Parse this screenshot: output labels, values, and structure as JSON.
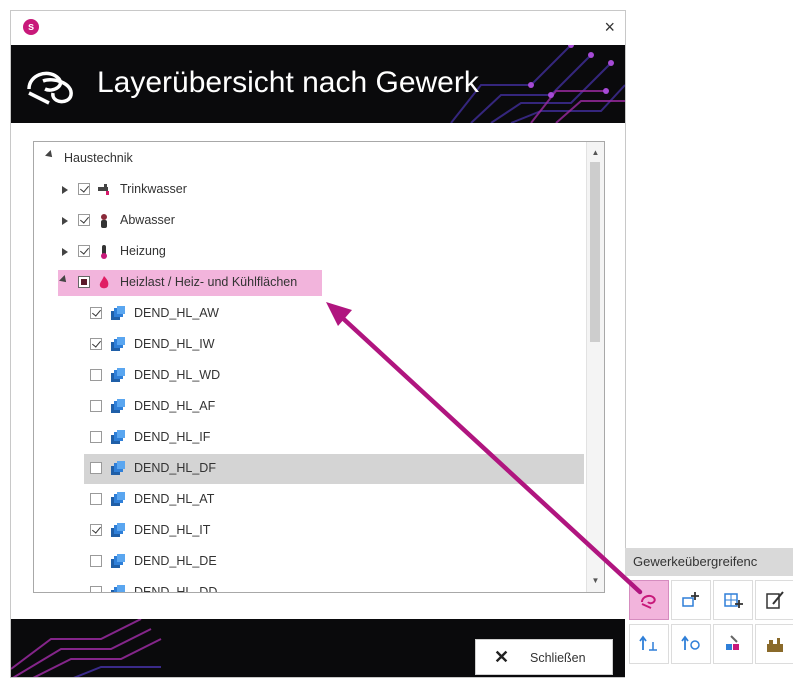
{
  "dialog": {
    "close_glyph": "×",
    "app_icon": "s-logo-icon",
    "app_icon_letter": "s",
    "title": "Layerübersicht nach Gewerk"
  },
  "tree": {
    "root": {
      "label": "Haustechnik",
      "expanded": true
    },
    "groups": [
      {
        "label": "Trinkwasser",
        "checked": true,
        "icon": "faucet-icon"
      },
      {
        "label": "Abwasser",
        "checked": true,
        "icon": "drain-icon"
      },
      {
        "label": "Heizung",
        "checked": true,
        "icon": "thermometer-icon"
      },
      {
        "label": "Heizlast / Heiz- und Kühlflächen",
        "state": "partial",
        "icon": "flame-icon",
        "expanded": true
      }
    ],
    "layers": [
      {
        "label": "DEND_HL_AW",
        "checked": true
      },
      {
        "label": "DEND_HL_IW",
        "checked": true
      },
      {
        "label": "DEND_HL_WD",
        "checked": false
      },
      {
        "label": "DEND_HL_AF",
        "checked": false
      },
      {
        "label": "DEND_HL_IF",
        "checked": false
      },
      {
        "label": "DEND_HL_DF",
        "checked": false,
        "selected": true
      },
      {
        "label": "DEND_HL_AT",
        "checked": false
      },
      {
        "label": "DEND_HL_IT",
        "checked": true
      },
      {
        "label": "DEND_HL_DE",
        "checked": false
      },
      {
        "label": "DEND_HL_DD",
        "checked": false
      }
    ]
  },
  "footer": {
    "close_label": "Schließen",
    "close_glyph": "✕"
  },
  "toolbar": {
    "title": "Gewerkeübergreifenc",
    "buttons": [
      {
        "name": "layer-overview-icon",
        "active": true
      },
      {
        "name": "add-layer-icon"
      },
      {
        "name": "add-grid-icon"
      },
      {
        "name": "edit-layer-icon"
      },
      {
        "name": "import-layer-icon"
      },
      {
        "name": "refresh-layer-icon"
      },
      {
        "name": "paint-layer-icon"
      },
      {
        "name": "building-icon"
      }
    ]
  },
  "colors": {
    "accent": "#c8197a",
    "highlight": "#f2b4dc",
    "selection": "#d4d4d4",
    "banner": "#0a0a0c",
    "layer_icon": "#2f7fd8"
  }
}
